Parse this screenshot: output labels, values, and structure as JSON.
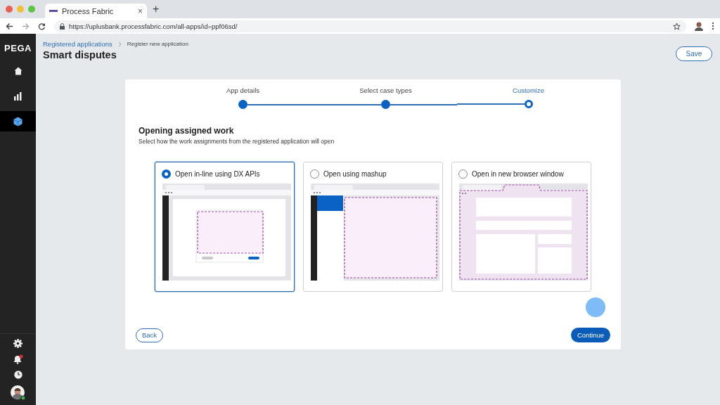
{
  "browser": {
    "tab_title": "Process Fabric",
    "tab_close": "×",
    "new_tab": "+",
    "url": "https://uplusbank.processfabric.com/all-apps/id=ppf06sd/"
  },
  "sidebar": {
    "logo": "PEGA",
    "items": [
      {
        "kind": "home",
        "selected": false
      },
      {
        "kind": "chart",
        "selected": false
      },
      {
        "kind": "cube",
        "selected": true
      }
    ],
    "footer_items": [
      {
        "kind": "settings"
      },
      {
        "kind": "notifications",
        "badge": true
      },
      {
        "kind": "history"
      },
      {
        "kind": "avatar",
        "online": true
      }
    ]
  },
  "breadcrumb": [
    {
      "label": "Registered applications",
      "kind": "link"
    },
    {
      "label": "Register new application",
      "kind": "current"
    }
  ],
  "title": "Smart disputes",
  "save_button": "Save",
  "stepper": {
    "steps": [
      {
        "label": "App details",
        "selected": false
      },
      {
        "label": "Select case types",
        "selected": false
      },
      {
        "label": "Customize",
        "selected": true
      }
    ]
  },
  "section": {
    "heading": "Opening assigned work",
    "description": "Select how the work assignments from the registered application will open"
  },
  "options": [
    {
      "label": "Open in-line using DX APIs",
      "kind": "inline",
      "selected": true
    },
    {
      "label": "Open using mashup",
      "kind": "mashup",
      "selected": false
    },
    {
      "label": "Open in new browser window",
      "kind": "window",
      "selected": false
    }
  ],
  "buttons": {
    "back": "Back",
    "continue": "Continue"
  },
  "cursor_highlight": true
}
